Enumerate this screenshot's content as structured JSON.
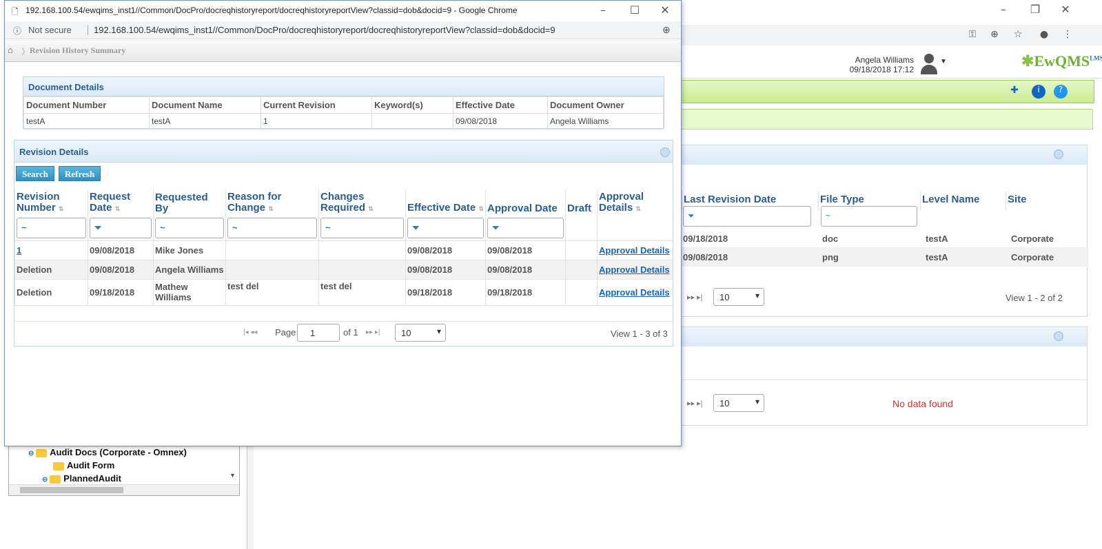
{
  "popup": {
    "title": "192.168.100.54/ewqims_inst1//Common/DocPro/docreqhistoryreport/docreqhistoryreportView?classid=dob&docid=9 - Google Chrome",
    "not_secure": "Not secure",
    "url": "192.168.100.54/ewqims_inst1//Common/DocPro/docreqhistoryreport/docreqhistoryreportView?classid=dob&docid=9",
    "breadcrumb": "Revision History Summary",
    "doc_panel": {
      "title": "Document Details",
      "headers": [
        "Document Number",
        "Document Name",
        "Current Revision",
        "Keyword(s)",
        "Effective Date",
        "Document Owner"
      ],
      "row": [
        "testA",
        "testA",
        "1",
        "",
        "09/08/2018",
        "Angela Williams"
      ]
    },
    "rev_panel": {
      "title": "Revision Details",
      "search": "Search",
      "refresh": "Refresh",
      "headers": [
        "Revision Number",
        "Request Date",
        "Requested By",
        "Reason for Change",
        "Changes Required",
        "Effective Date",
        "Approval Date",
        "Draft",
        "Approval Details"
      ],
      "filters": [
        "~",
        "⏷",
        "~",
        "~",
        "~",
        "⏷",
        "⏷"
      ],
      "rows": [
        [
          "1",
          "09/08/2018",
          "Mike Jones",
          "",
          "",
          "09/08/2018",
          "09/08/2018",
          "",
          "Approval Details"
        ],
        [
          "Deletion",
          "09/08/2018",
          "Angela  Williams",
          "",
          "",
          "09/08/2018",
          "09/08/2018",
          "",
          "Approval Details"
        ],
        [
          "Deletion",
          "09/18/2018",
          "Mathew Williams",
          "test del",
          "test del",
          "09/18/2018",
          "09/18/2018",
          "",
          "Approval Details"
        ]
      ],
      "pager": {
        "page_label": "Page",
        "page": "1",
        "of": "of 1",
        "size": "10",
        "view": "View 1 - 3 of 3"
      }
    }
  },
  "bg": {
    "user": "Angela Williams",
    "datetime": "09/18/2018 17:12",
    "logo": "EwQMS",
    "logo_sup": "LMS",
    "headers": [
      "Last Revision Date",
      "File Type",
      "Level Name",
      "Site"
    ],
    "rows": [
      [
        "09/18/2018",
        "doc",
        "testA",
        "Corporate"
      ],
      [
        "09/08/2018",
        "png",
        "testA",
        "Corporate"
      ]
    ],
    "size": "10",
    "view": "View 1 - 2 of 2",
    "size2": "10",
    "no_data": "No data found",
    "tree": [
      "Audit Docs (Corporate - Omnex)",
      "Audit Form",
      "PlannedAudit"
    ]
  },
  "colors": {
    "accent": "#2a5d91",
    "green": "#c9ec8f",
    "link": "#1565c0",
    "nodata": "#d32f2f"
  }
}
